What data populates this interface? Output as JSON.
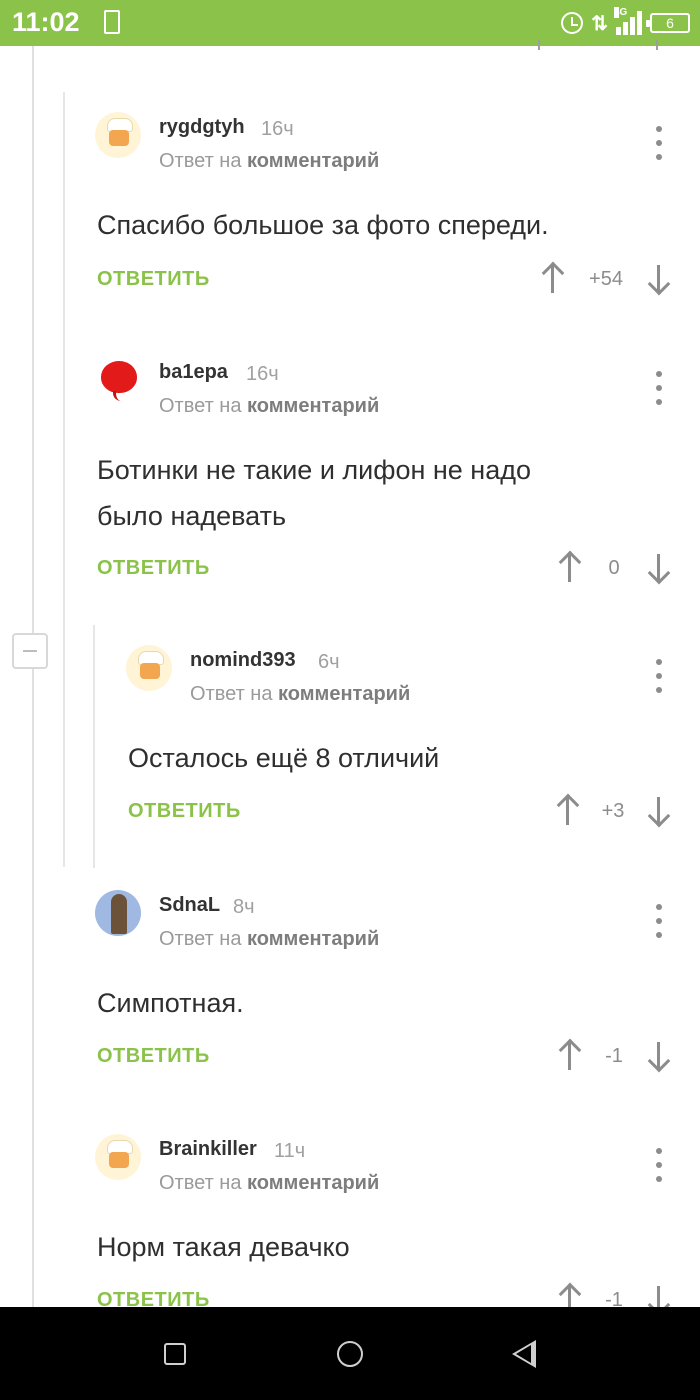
{
  "status_bar": {
    "time": "11:02",
    "network": "4G",
    "battery": "6",
    "icons": [
      "sim-icon",
      "alarm-icon",
      "data-transfer-icon",
      "signal-icon",
      "battery-icon"
    ]
  },
  "comments": [
    {
      "username": "rygdgtyh",
      "time": "16ч",
      "reply_prefix": "Ответ на",
      "reply_target": "комментарий",
      "text_lines": [
        "Спасибо большое за фото спереди."
      ],
      "reply_label": "ОТВЕТИТЬ",
      "rating": "+54",
      "avatar": "chef-avatar"
    },
    {
      "username": "ba1epa",
      "time": "16ч",
      "reply_prefix": "Ответ на",
      "reply_target": "комментарий",
      "text_lines": [
        "Ботинки не такие и лифон не надо",
        "было надевать"
      ],
      "reply_label": "ОТВЕТИТЬ",
      "rating": "0",
      "avatar": "balloon-avatar"
    },
    {
      "username": "nomind393",
      "time": "6ч",
      "reply_prefix": "Ответ на",
      "reply_target": "комментарий",
      "text_lines": [
        "Осталось ещё 8 отличий"
      ],
      "reply_label": "ОТВЕТИТЬ",
      "rating": "+3",
      "avatar": "chef-avatar"
    },
    {
      "username": "SdnaL",
      "time": "8ч",
      "reply_prefix": "Ответ на",
      "reply_target": "комментарий",
      "text_lines": [
        "Симпотная."
      ],
      "reply_label": "ОТВЕТИТЬ",
      "rating": "-1",
      "avatar": "photo-avatar"
    },
    {
      "username": "Brainkiller",
      "time": "11ч",
      "reply_prefix": "Ответ на",
      "reply_target": "комментарий",
      "text_lines": [
        "Норм такая девачко"
      ],
      "reply_label": "ОТВЕТИТЬ",
      "rating": "-1",
      "avatar": "chef-avatar"
    }
  ],
  "nav_bar": {
    "buttons": [
      "recent-apps-button",
      "home-button",
      "back-button"
    ]
  },
  "colors": {
    "accent": "#8bc34a",
    "text": "#2f2f2f",
    "muted": "#9a9a9a"
  }
}
